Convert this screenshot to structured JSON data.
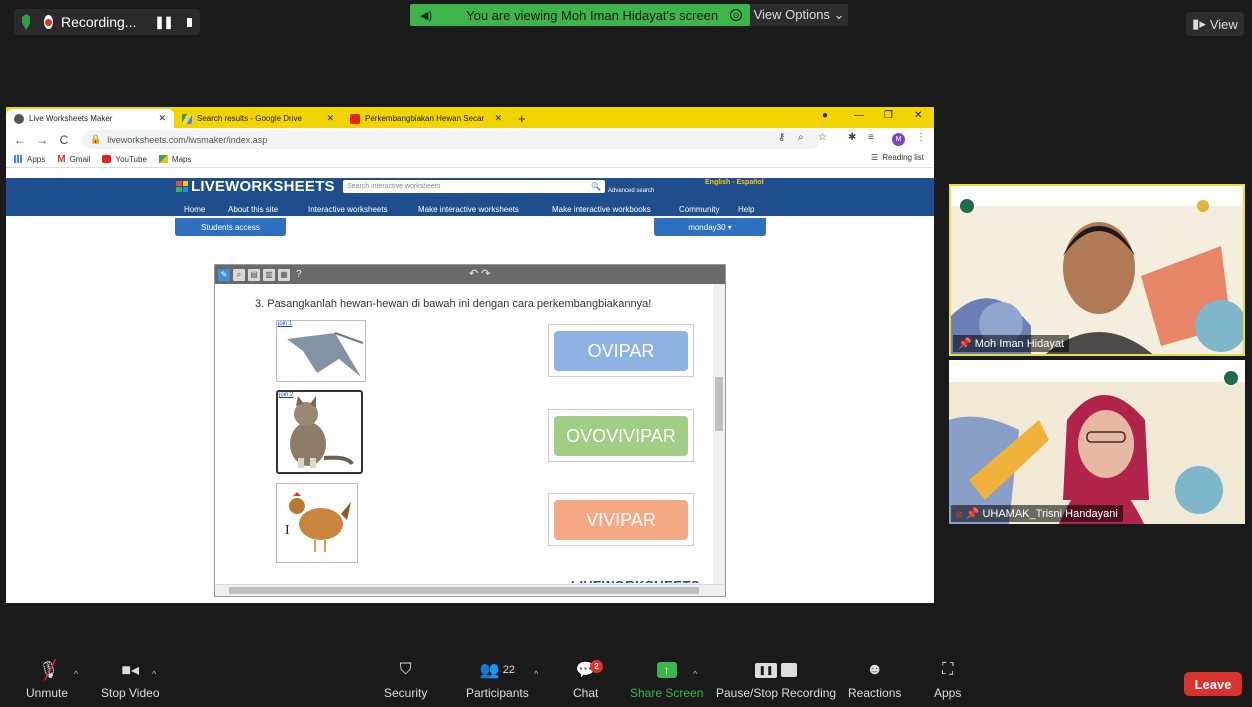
{
  "zoom": {
    "recording_label": "Recording...",
    "viewing_banner": "You are viewing Moh Iman Hidayat's screen",
    "view_options": "View Options ⌄",
    "view_button": "View",
    "toolbar": {
      "unmute": "Unmute",
      "stop_video": "Stop Video",
      "security": "Security",
      "participants": "Participants",
      "participants_count": "22",
      "chat": "Chat",
      "chat_badge": "2",
      "share_screen": "Share Screen",
      "pause_stop_recording": "Pause/Stop Recording",
      "reactions": "Reactions",
      "apps": "Apps",
      "leave": "Leave"
    },
    "participants_tiles": [
      {
        "name": "Moh Iman Hidayat"
      },
      {
        "name": "UHAMAK_Trisni Handayani"
      }
    ],
    "colors": {
      "share_green": "#3db54a",
      "leave_red": "#d9312b"
    }
  },
  "browser": {
    "tabs": [
      {
        "title": "Live Worksheets Maker"
      },
      {
        "title": "Search results - Google Drive"
      },
      {
        "title": "Perkembangbiakan Hewan Secar"
      }
    ],
    "url": "liveworksheets.com/lwsmaker/index.asp",
    "bookmarks": [
      "Apps",
      "Gmail",
      "YouTube",
      "Maps"
    ],
    "reading_list": "Reading list",
    "profile_initial": "M"
  },
  "page": {
    "logo": "LIVEWORKSHEETS",
    "search_placeholder": "Search interactive worksheets",
    "advanced_search": "Advanced search",
    "language": "English - Español",
    "nav": [
      "Home",
      "About this site",
      "Interactive worksheets",
      "Make interactive worksheets",
      "Make interactive workbooks",
      "Community",
      "Help"
    ],
    "students_access": "Students access",
    "user_menu": "monday30 ▾",
    "worksheet": {
      "question": "3.  Pasangkanlah hewan-hewan di bawah ini dengan cara perkembangbiakannya!",
      "image_labels": [
        "join:1",
        "join:2"
      ],
      "answers": [
        "OVIPAR",
        "OVOVIVIPAR",
        "VIVIPAR"
      ],
      "footer_logo": "LIVEWORKSHEETS",
      "toolbar_help": "?"
    }
  }
}
